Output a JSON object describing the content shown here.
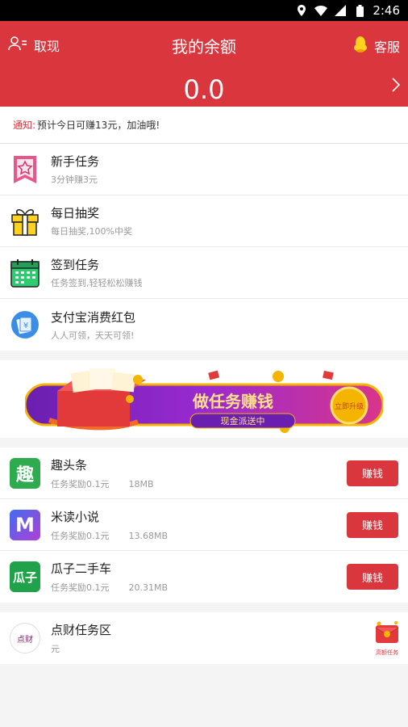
{
  "status_bar": {
    "time": "2:46"
  },
  "header": {
    "withdraw_label": "取现",
    "title": "我的余额",
    "service_label": "客服",
    "balance": "0.0"
  },
  "notice": {
    "label": "通知:",
    "text": "预计今日可赚13元，加油哦!"
  },
  "tasks": [
    {
      "title": "新手任务",
      "subtitle": "3分钟赚3元",
      "icon": "ribbon-star-icon"
    },
    {
      "title": "每日抽奖",
      "subtitle": "每日抽奖,100%中奖",
      "icon": "gift-box-icon"
    },
    {
      "title": "签到任务",
      "subtitle": "任务签到,轻轻松松赚钱",
      "icon": "calendar-icon"
    },
    {
      "title": "支付宝消费红包",
      "subtitle": "人人可领，天天可领!",
      "icon": "alipay-voucher-icon"
    }
  ],
  "banner": {
    "headline": "做任务赚钱",
    "sub": "现金派送中",
    "badge": "立即升级"
  },
  "apps": [
    {
      "name": "趣头条",
      "reward": "任务奖励0.1元",
      "size": "18MB",
      "button": "赚钱",
      "icon_text": "趣",
      "icon_color": "#2eab4f"
    },
    {
      "name": "米读小说",
      "reward": "任务奖励0.1元",
      "size": "13.68MB",
      "button": "赚钱",
      "icon_text": "M",
      "icon_color": "#7b3fe4"
    },
    {
      "name": "瓜子二手车",
      "reward": "任务奖励0.1元",
      "size": "20.31MB",
      "button": "赚钱",
      "icon_text": "瓜子",
      "icon_color": "#1fa24a"
    }
  ],
  "zone": {
    "icon_text": "点财",
    "title": "点财任务区",
    "subtitle": "元",
    "badge_label": "高额任务"
  },
  "colors": {
    "primary": "#d9363e",
    "background": "#f4f4f4"
  }
}
